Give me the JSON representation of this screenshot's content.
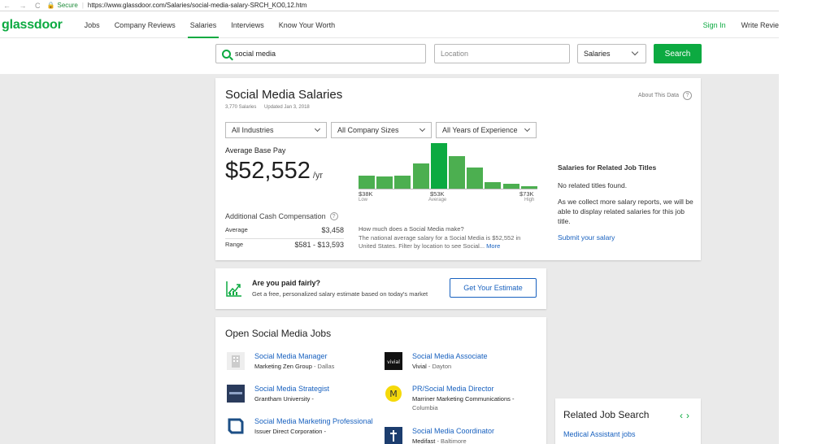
{
  "browser": {
    "nav_glyphs": "← → C",
    "secure": "Secure",
    "url": "https://www.glassdoor.com/Salaries/social-media-salary-SRCH_KO0,12.htm"
  },
  "nav": {
    "logo": "glassdoor",
    "links": [
      "Jobs",
      "Company Reviews",
      "Salaries",
      "Interviews",
      "Know Your Worth"
    ],
    "sign_in": "Sign In",
    "write": "Write Revie"
  },
  "search": {
    "keyword": "social media",
    "location_placeholder": "Location",
    "type": "Salaries",
    "button": "Search"
  },
  "salary": {
    "title": "Social Media Salaries",
    "count": "3,770 Salaries",
    "updated": "Updated Jan 3, 2018",
    "about": "About This Data",
    "filters": [
      "All Industries",
      "All Company Sizes",
      "All Years of Experience"
    ],
    "avg_label": "Average Base Pay",
    "avg_value": "$52,552",
    "per": "/yr",
    "add_comp_label": "Additional Cash Compensation",
    "average_label": "Average",
    "average_value": "$3,458",
    "range_label": "Range",
    "range_value": "$581 - $13,593",
    "axis": {
      "low_value": "$38K",
      "low_label": "Low",
      "avg_value": "$53K",
      "avg_label": "Average",
      "high_value": "$73K",
      "high_label": "High"
    },
    "histogram": [
      0.28,
      0.26,
      0.28,
      0.55,
      1.0,
      0.72,
      0.46,
      0.14,
      0.1,
      0.05
    ],
    "histogram_highlight": 4,
    "how_much_q": "How much does a Social Media make?",
    "how_much_text": "The national average salary for a Social Media is $52,552 in United States. Filter by location to see Social...",
    "more": "More"
  },
  "related_titles": {
    "heading": "Salaries for Related Job Titles",
    "none": "No related titles found.",
    "note": "As we collect more salary reports, we will be able to display related salaries for this job title.",
    "submit": "Submit your salary"
  },
  "fair": {
    "heading": "Are you paid fairly?",
    "sub": "Get a free, personalized salary estimate based on today's market",
    "button": "Get Your Estimate"
  },
  "jobs": {
    "heading": "Open Social Media Jobs",
    "items": [
      {
        "title": "Social Media Manager",
        "company": "Marketing Zen Group",
        "city": " - Dallas",
        "logo": "building-icon"
      },
      {
        "title": "Social Media Associate",
        "company": "Vivial",
        "city": " - Dayton",
        "logo": "vivial-logo",
        "logo_text": "vivial"
      },
      {
        "title": "Social Media Strategist",
        "company": "Grantham University -",
        "city": "",
        "logo": "grantham-logo"
      },
      {
        "title": "PR/Social Media Director",
        "company": "Marriner Marketing Communications -",
        "city": "Columbia",
        "logo": "marriner-logo",
        "logo_text": "M"
      },
      {
        "title": "Social Media Marketing Professional",
        "company": "Issuer Direct Corporation -",
        "city": "",
        "logo": "issuer-direct-logo"
      },
      {
        "title": "Social Media Coordinator",
        "company": "Medifast",
        "city": " - Baltimore",
        "logo": "medifast-logo"
      }
    ]
  },
  "related_search": {
    "heading": "Related Job Search",
    "link": "Medical Assistant jobs"
  },
  "colors": {
    "brand_green": "#0caa41",
    "link_blue": "#1861bf",
    "bar_green": "#4caf50",
    "page_grey": "#eaeaea"
  }
}
